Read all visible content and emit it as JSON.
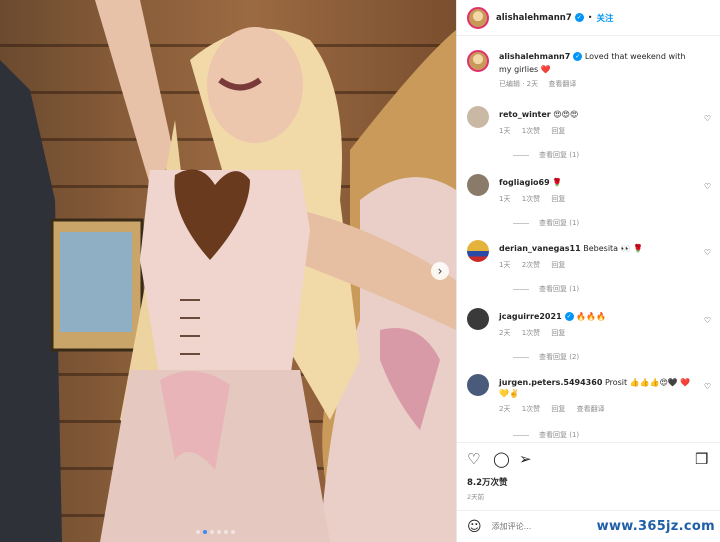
{
  "post": {
    "author": "alishalehmann7",
    "follow_label": "关注",
    "more_label": "•",
    "caption": "Loved that weekend with my girlies ❤️",
    "caption_meta": {
      "edited": "已编辑 · 2天",
      "translate": "查看翻译"
    }
  },
  "photo": {
    "next_arrow": "›",
    "dots_count": 6,
    "active_dot": 1
  },
  "comments": [
    {
      "user": "reto_winter",
      "text": "😍😍😍",
      "time": "1天",
      "likes": "1次赞",
      "reply": "回复",
      "translate": "",
      "replies": "查看回复 (1)",
      "avatar_color": "#c9b9a4"
    },
    {
      "user": "fogliagio69",
      "text": "🌹",
      "time": "1天",
      "likes": "1次赞",
      "reply": "回复",
      "translate": "",
      "replies": "查看回复 (1)",
      "avatar_color": "#8a7a6a"
    },
    {
      "user": "derian_vanegas11",
      "text": "Bebesita 👀 🌹",
      "time": "1天",
      "likes": "2次赞",
      "reply": "回复",
      "translate": "",
      "replies": "查看回复 (1)",
      "avatar_color": "#e3b33b"
    },
    {
      "user": "jcaguirre2021",
      "text": "🔥🔥🔥",
      "time": "2天",
      "likes": "1次赞",
      "reply": "回复",
      "translate": "",
      "replies": "查看回复 (2)",
      "avatar_color": "#3a3a3a"
    },
    {
      "user": "jurgen.peters.5494360",
      "text": "Prosit 👍👍👍😍🖤 ❤️💛✌️",
      "time": "2天",
      "likes": "1次赞",
      "reply": "回复",
      "translate": "查看翻译",
      "replies": "查看回复 (1)",
      "avatar_color": "#4a5a7a"
    }
  ],
  "actions": {
    "like_icon": "heart-icon",
    "comment_icon": "comment-icon",
    "share_icon": "share-icon",
    "save_icon": "bookmark-icon",
    "likes": "8.2万次赞",
    "posted": "2天前"
  },
  "comment_input": {
    "placeholder": "添加评论..."
  },
  "watermark": "www.365jz.com",
  "colors": {
    "link": "#0095f6",
    "muted": "#8e8e8e",
    "text": "#262626",
    "ring": "#e1306c"
  }
}
